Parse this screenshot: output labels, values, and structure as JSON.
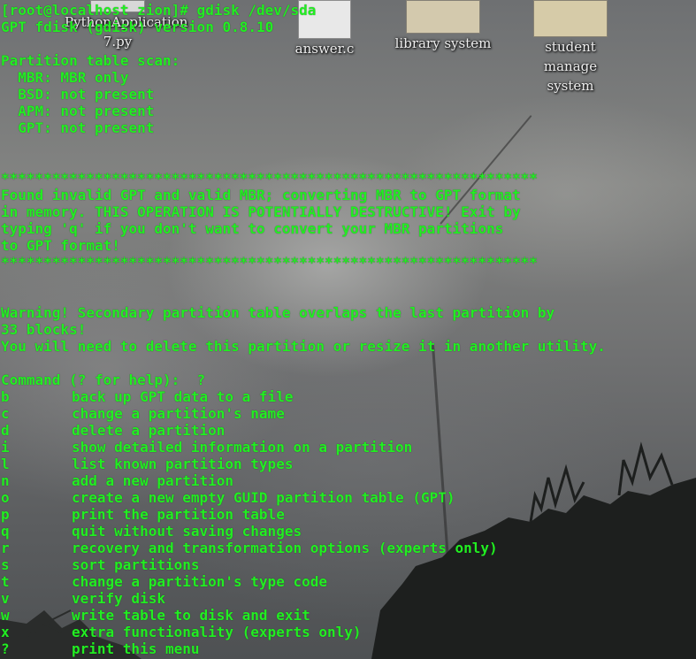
{
  "terminal": {
    "prompt": "[root@localhost zion]# gdisk /dev/sda",
    "version": "GPT fdisk (gdisk) version 0.8.10",
    "scan_header": "Partition table scan:",
    "scan": [
      "  MBR: MBR only",
      "  BSD: not present",
      "  APM: not present",
      "  GPT: not present"
    ],
    "stars": "***************************************************************",
    "notice": [
      "Found invalid GPT and valid MBR; converting MBR to GPT format",
      "in memory. THIS OPERATION IS POTENTIALLY DESTRUCTIVE! Exit by",
      "typing 'q' if you don't want to convert your MBR partitions",
      "to GPT format!"
    ],
    "warning": [
      "Warning! Secondary partition table overlaps the last partition by",
      "33 blocks!",
      "You will need to delete this partition or resize it in another utility."
    ],
    "command_prompt": "Command (? for help):  ?",
    "commands": [
      {
        "key": "b",
        "desc": "back up GPT data to a file"
      },
      {
        "key": "c",
        "desc": "change a partition's name"
      },
      {
        "key": "d",
        "desc": "delete a partition"
      },
      {
        "key": "i",
        "desc": "show detailed information on a partition"
      },
      {
        "key": "l",
        "desc": "list known partition types"
      },
      {
        "key": "n",
        "desc": "add a new partition"
      },
      {
        "key": "o",
        "desc": "create a new empty GUID partition table (GPT)"
      },
      {
        "key": "p",
        "desc": "print the partition table"
      },
      {
        "key": "q",
        "desc": "quit without saving changes"
      },
      {
        "key": "r",
        "desc": "recovery and transformation options (experts only)"
      },
      {
        "key": "s",
        "desc": "sort partitions"
      },
      {
        "key": "t",
        "desc": "change a partition's type code"
      },
      {
        "key": "v",
        "desc": "verify disk"
      },
      {
        "key": "w",
        "desc": "write table to disk and exit"
      },
      {
        "key": "x",
        "desc": "extra functionality (experts only)"
      },
      {
        "key": "?",
        "desc": "print this menu"
      }
    ],
    "text_color": "#22ee22"
  },
  "desktop": {
    "icons": [
      {
        "label": "PythonApplication",
        "label2": "7.py",
        "icon": "python-file-icon"
      },
      {
        "label": "answer.c",
        "icon": "c-source-file-icon"
      },
      {
        "label": "library system",
        "icon": "folder-icon"
      },
      {
        "label": "student manage",
        "label2": "system",
        "icon": "folder-icon"
      }
    ]
  }
}
